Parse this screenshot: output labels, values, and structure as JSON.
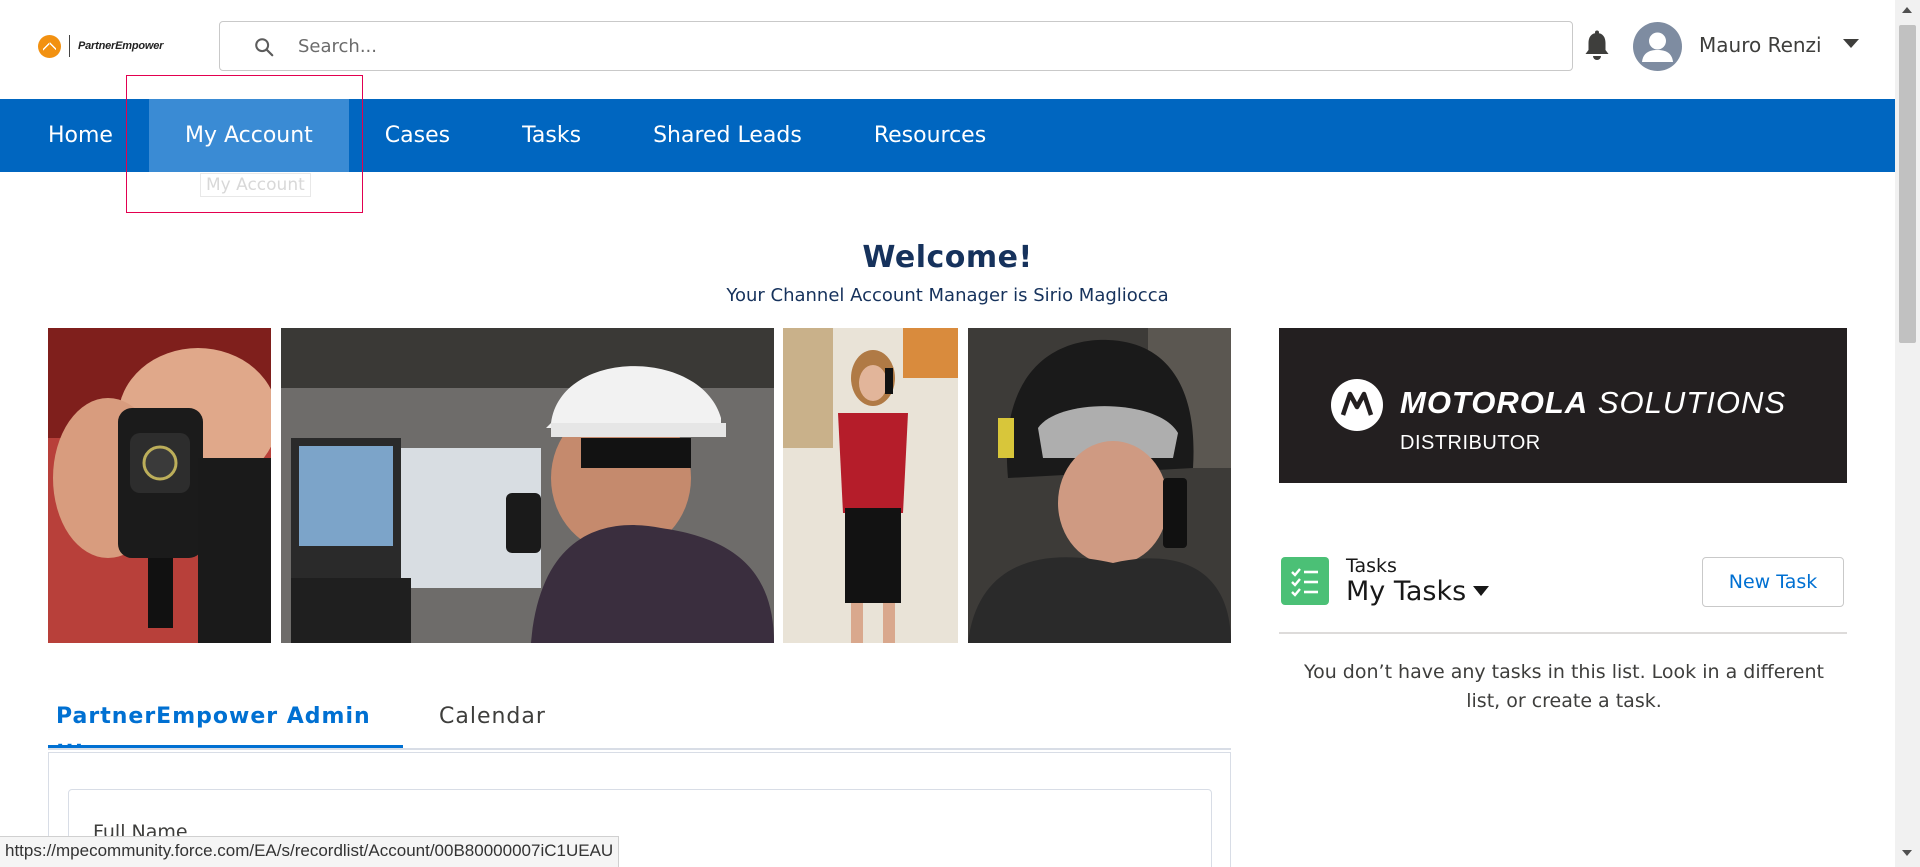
{
  "header": {
    "logo_text": "PartnerEmpower",
    "search_placeholder": "Search...",
    "user_name": "Mauro Renzi"
  },
  "nav": {
    "items": [
      {
        "label": "Home"
      },
      {
        "label": "My Account",
        "active": true
      },
      {
        "label": "Cases"
      },
      {
        "label": "Tasks"
      },
      {
        "label": "Shared Leads"
      },
      {
        "label": "Resources"
      }
    ],
    "hover_tooltip": "My Account"
  },
  "welcome": {
    "title": "Welcome!",
    "subtitle": "Your Channel Account Manager is Sirio Magliocca"
  },
  "banner": {
    "brand_bold": "MOTOROLA",
    "brand_light": " SOLUTIONS",
    "sub": "DISTRIBUTOR"
  },
  "tasks": {
    "small_label": "Tasks",
    "title": "My Tasks",
    "new_button": "New Task",
    "empty_message": "You don’t have any tasks in this list. Look in a different list, or create a task."
  },
  "tabs": {
    "admin": "PartnerEmpower Admin ...",
    "calendar": "Calendar"
  },
  "form": {
    "field_label": "Full Name"
  },
  "status_url": "https://mpecommunity.force.com/EA/s/recordlist/Account/00B80000007iC1UEAU",
  "colors": {
    "nav_bg": "#0066c0",
    "nav_active": "#3a8bd4",
    "link": "#0070d2",
    "tasks_icon": "#4bc076",
    "highlight": "#e3004f"
  }
}
